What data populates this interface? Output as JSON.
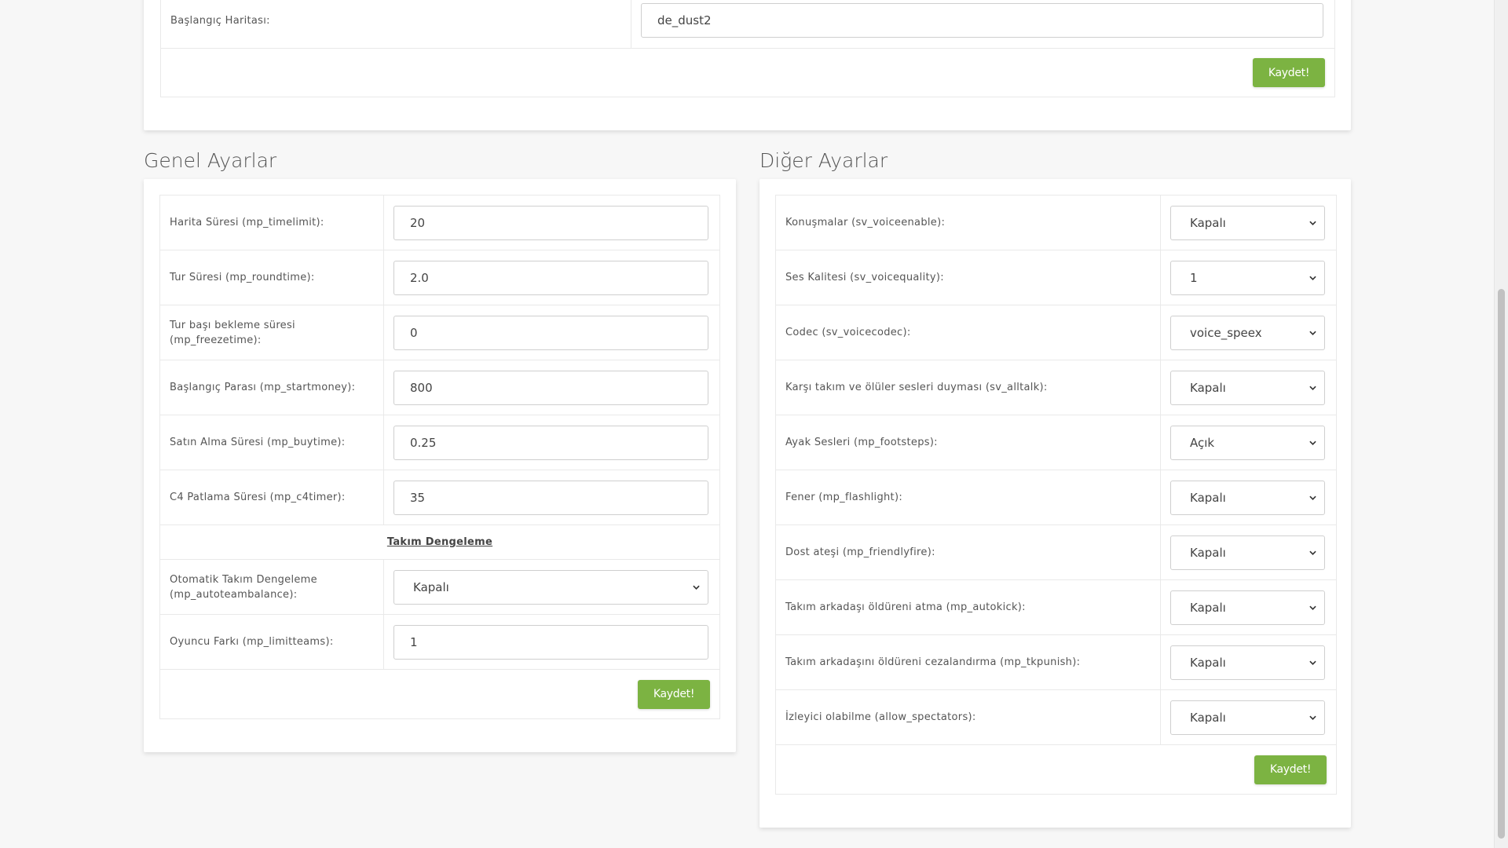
{
  "top": {
    "start_map_label": "Başlangıç Haritası:",
    "start_map_value": "de_dust2",
    "save_label": "Kaydet!"
  },
  "general": {
    "title": "Genel Ayarlar",
    "rows": [
      {
        "label": "Harita Süresi (mp_timelimit):",
        "value": "20"
      },
      {
        "label": "Tur Süresi (mp_roundtime):",
        "value": "2.0"
      },
      {
        "label": "Tur başı bekleme süresi (mp_freezetime):",
        "value": "0"
      },
      {
        "label": "Başlangıç Parası (mp_startmoney):",
        "value": "800"
      },
      {
        "label": "Satın Alma Süresi (mp_buytime):",
        "value": "0.25"
      },
      {
        "label": "C4 Patlama Süresi (mp_c4timer):",
        "value": "35"
      }
    ],
    "team_balance_heading": "Takım Dengeleme",
    "autobalance_label": "Otomatik Takım Dengeleme (mp_autoteambalance):",
    "autobalance_value": "Kapalı",
    "limitteams_label": "Oyuncu Farkı (mp_limitteams):",
    "limitteams_value": "1",
    "save_label": "Kaydet!"
  },
  "other": {
    "title": "Diğer Ayarlar",
    "rows": [
      {
        "label": "Konuşmalar (sv_voiceenable):",
        "value": "Kapalı"
      },
      {
        "label": "Ses Kalitesi (sv_voicequality):",
        "value": "1"
      },
      {
        "label": "Codec (sv_voicecodec):",
        "value": "voice_speex"
      },
      {
        "label": "Karşı takım ve ölüler sesleri duyması (sv_alltalk):",
        "value": "Kapalı"
      },
      {
        "label": "Ayak Sesleri (mp_footsteps):",
        "value": "Açık"
      },
      {
        "label": "Fener (mp_flashlight):",
        "value": "Kapalı"
      },
      {
        "label": "Dost ateşi (mp_friendlyfire):",
        "value": "Kapalı"
      },
      {
        "label": "Takım arkadaşı öldüreni atma (mp_autokick):",
        "value": "Kapalı"
      },
      {
        "label": "Takım arkadaşını öldüreni cezalandırma (mp_tkpunish):",
        "value": "Kapalı"
      },
      {
        "label": "İzleyici olabilme (allow_spectators):",
        "value": "Kapalı"
      }
    ],
    "save_label": "Kaydet!"
  }
}
